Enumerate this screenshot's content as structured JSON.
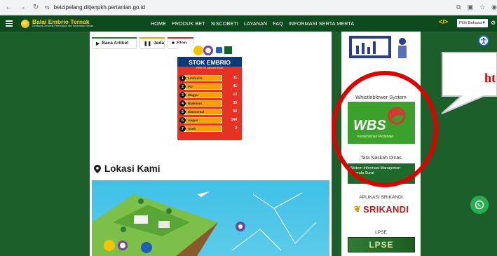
{
  "browser": {
    "url": "betcipelang.ditjenpkh.pertanian.go.id"
  },
  "nav": {
    "brand_title": "Balai Embrio Ternak",
    "brand_subtitle": "Direktorat Jenderal Peternakan dan Kesehatan Hewan",
    "menu": [
      "HOME",
      "PRODUK BET",
      "SISCOBETI",
      "LAYANAN",
      "FAQ",
      "INFORMASI SERTA MERTA"
    ],
    "language": "Pilih Bahasa▼"
  },
  "article_buttons": {
    "read": "Baca Artikel",
    "pause": "Jeda",
    "stop": "Stop"
  },
  "stok": {
    "title": "STOK EMBRIO",
    "date": "PER 03 Januari 2025",
    "rows": [
      {
        "num": "1",
        "name": "Limousin",
        "value": "11"
      },
      {
        "num": "2",
        "name": "PO",
        "value": "41"
      },
      {
        "num": "3",
        "name": "Wagyu",
        "value": "13"
      },
      {
        "num": "4",
        "name": "Brahman",
        "value": "30"
      },
      {
        "num": "5",
        "name": "Simmental",
        "value": "54"
      },
      {
        "num": "6",
        "name": "Angus",
        "value": "144"
      },
      {
        "num": "7",
        "name": "Aceh",
        "value": "2"
      }
    ]
  },
  "lokasi": {
    "title": "Lokasi Kami"
  },
  "sidebar": {
    "whistleblower_title": "Whistleblower System",
    "wbs_logo": "WBS",
    "wbs_caption": "Kementerian Pertanian",
    "naskah_title": "Tata Naskah Dinas",
    "naskah_text": "Sistem Informasi Manajemen Agenda Surat",
    "srikandi_title": "APLIKASI SRIKANDI",
    "srikandi_logo": "SRIKANDI",
    "lpse_title": "LPSE",
    "lpse_logo": "LPSE"
  },
  "annotation": {
    "callout_text": "ht"
  },
  "colors": {
    "nav_bg": "#0d4a1e",
    "page_green": "#1c5f2a",
    "accent_yellow": "#ffd400",
    "stok_red": "#e63223",
    "annotation_red": "#e00000"
  },
  "icons": [
    "back-arrow-icon",
    "forward-arrow-icon",
    "reload-icon",
    "site-settings-icon",
    "translate-icon",
    "star-icon",
    "menu-icon",
    "play-icon",
    "pause-icon",
    "stop-icon",
    "location-pin-icon",
    "whatsapp-icon",
    "accessibility-icon",
    "code-icon"
  ]
}
